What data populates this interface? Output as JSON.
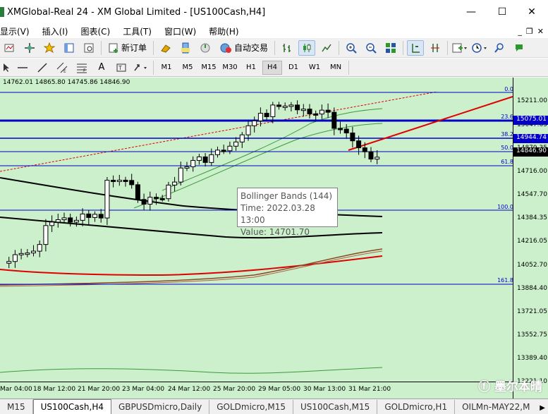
{
  "window": {
    "title": "XMGlobal-Real 24 - XM Global Limited - [US100Cash,H4]",
    "minimize": "—",
    "maximize": "☐",
    "close": "✕"
  },
  "menu": {
    "items": [
      "显示(V)",
      "插入(I)",
      "图表(C)",
      "工具(T)",
      "窗口(W)",
      "帮助(H)"
    ],
    "right": [
      "_",
      "❐",
      "✕"
    ]
  },
  "toolbar": {
    "new_order": "新订单",
    "auto_trading": "自动交易"
  },
  "timeframes": [
    "M1",
    "M5",
    "M15",
    "M30",
    "H1",
    "H4",
    "D1",
    "W1",
    "MN"
  ],
  "active_timeframe": "H4",
  "chart": {
    "ohlc": "14762.01 14865.80 14745.86 14846.90",
    "tooltip": {
      "line1": "Bollinger Bands (144)",
      "line2": "Time: 2022.03.28 13:00",
      "line3": "Value: 14701.70"
    },
    "price_labels": [
      "15211.00",
      "15047.65",
      "14879.35",
      "14716.00",
      "14547.70",
      "14384.35",
      "14216.05",
      "14052.70",
      "13884.40",
      "13721.05",
      "13552.75",
      "13389.40",
      "13221.10"
    ],
    "highlight_labels": [
      "15075.01",
      "14944.74",
      "14846.90"
    ],
    "fib_levels": [
      "0.0",
      "23.6",
      "38.2",
      "50.0",
      "61.8",
      "100.0",
      "161.8"
    ],
    "time_labels": [
      "Mar 04:00",
      "18 Mar 12:00",
      "21 Mar 20:00",
      "23 Mar 04:00",
      "24 Mar 12:00",
      "25 Mar 20:00",
      "29 Mar 05:00",
      "30 Mar 13:00",
      "31 Mar 21:00"
    ]
  },
  "tabs": [
    "M15",
    "US100Cash,H4",
    "GBPUSDmicro,Daily",
    "GOLDmicro,M15",
    "US100Cash,M15",
    "GOLDmicro,H1",
    "OILMn-MAY22,M"
  ],
  "active_tab": "US100Cash,H4",
  "watermark": "墨尔本晴",
  "colors": {
    "chart_bg": "#ccf0cc",
    "fib_line": "#0000c8",
    "trendline": "#e00000"
  }
}
